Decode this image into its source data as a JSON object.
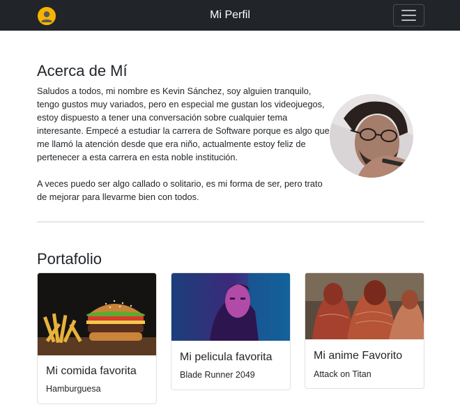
{
  "navbar": {
    "title": "Mi Perfil",
    "avatar_icon": "user-avatar-icon",
    "menu_icon": "hamburger-menu-icon",
    "background": "#212529",
    "avatar_color": "#f5b400"
  },
  "about": {
    "title": "Acerca de Mí",
    "paragraph1": "Saludos a todos, mi nombre es Kevin Sánchez, soy alguien tranquilo, tengo gustos muy variados, pero en especial me gustan los videojuegos, estoy dispuesto a tener una conversación sobre cualquier tema interesante. Empecé a estudiar la carrera de Software porque es algo que me llamó la atención desde que era niño, actualmente estoy feliz de pertenecer a esta carrera en esta noble institución.",
    "paragraph2": "A veces puedo ser algo callado o solitario, es mi forma de ser, pero trato de mejorar para llevarme bien con todos."
  },
  "portfolio": {
    "title": "Portafolio",
    "cards": [
      {
        "title": "Mi comida favorita",
        "text": "Hamburguesa"
      },
      {
        "title": "Mi pelicula favorita",
        "text": "Blade Runner 2049"
      },
      {
        "title": "Mi anime Favorito",
        "text": "Attack on Titan"
      }
    ]
  }
}
